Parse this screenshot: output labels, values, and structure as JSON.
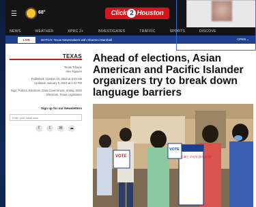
{
  "header": {
    "menu_icon": "hamburger-icon",
    "weather_icon": "sun-icon",
    "temperature": "68°",
    "logo_prefix": "Click",
    "logo_number": "2",
    "logo_suffix": "Houston",
    "logo_color": "#d7141a"
  },
  "nav": {
    "items": [
      "NEWS",
      "WEATHER",
      "KPRC 2+",
      "INVESTIGATES",
      "TRAFFIC",
      "SPORTS",
      "DISCOVE"
    ]
  },
  "banner": {
    "badge": "LIVE",
    "headline": "WATCH: Texas Newsmakers with Sharmini Marshall",
    "open_label": "OPEN ⌄"
  },
  "article": {
    "section": "TEXAS",
    "byline_1": "Texas Tribune",
    "byline_2": "Alex Nguyen",
    "published": "Published: October 10, 2022 at 5:00 AM",
    "updated": "Updated: January 6, 2023 at 1:23 PM",
    "tags": "Tags: Politics, Elections, Data Government, Voting, 2022 Elections, Texas Legislature",
    "headline": "Ahead of elections, Asian American and Pacific Islander organizers try to break down language barriers"
  },
  "newsletter": {
    "title": "Sign up for our Newsletters",
    "placeholder": "Enter your email here"
  },
  "social": {
    "icons": [
      "facebook-icon",
      "twitter-icon",
      "email-icon",
      "share-icon"
    ],
    "glyphs": [
      "f",
      "t",
      "✉",
      "☁"
    ]
  },
  "photo": {
    "sign_1": "VOTE",
    "sign_2": "VOTE",
    "poster_text": "투표는 우리의 권리입니다"
  }
}
